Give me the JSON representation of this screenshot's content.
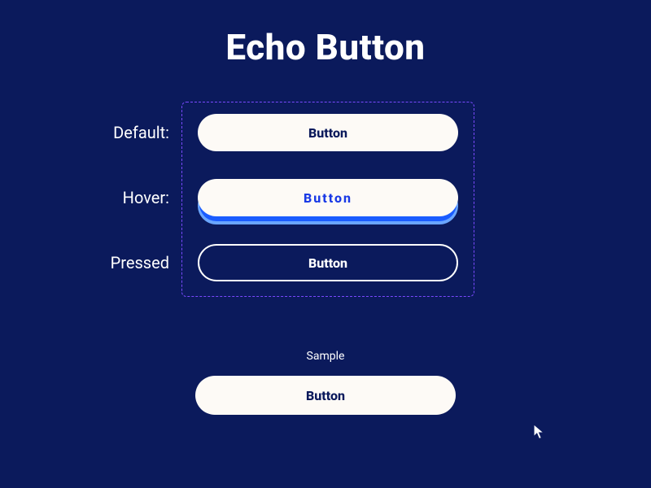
{
  "title": "Echo Button",
  "states": {
    "default_label": "Default:",
    "hover_label": "Hover:",
    "pressed_label": "Pressed",
    "default_text": "Button",
    "hover_text": "Button",
    "pressed_text": "Button"
  },
  "sample": {
    "label": "Sample",
    "button_text": "Button"
  },
  "colors": {
    "background": "#0b1a5c",
    "button_fill": "#fdfaf6",
    "hover_text": "#1a3ae6",
    "hover_shadow_top": "#1a5cff",
    "hover_shadow_bottom": "#6aa6ff",
    "dashed_border": "#7a49ff"
  }
}
